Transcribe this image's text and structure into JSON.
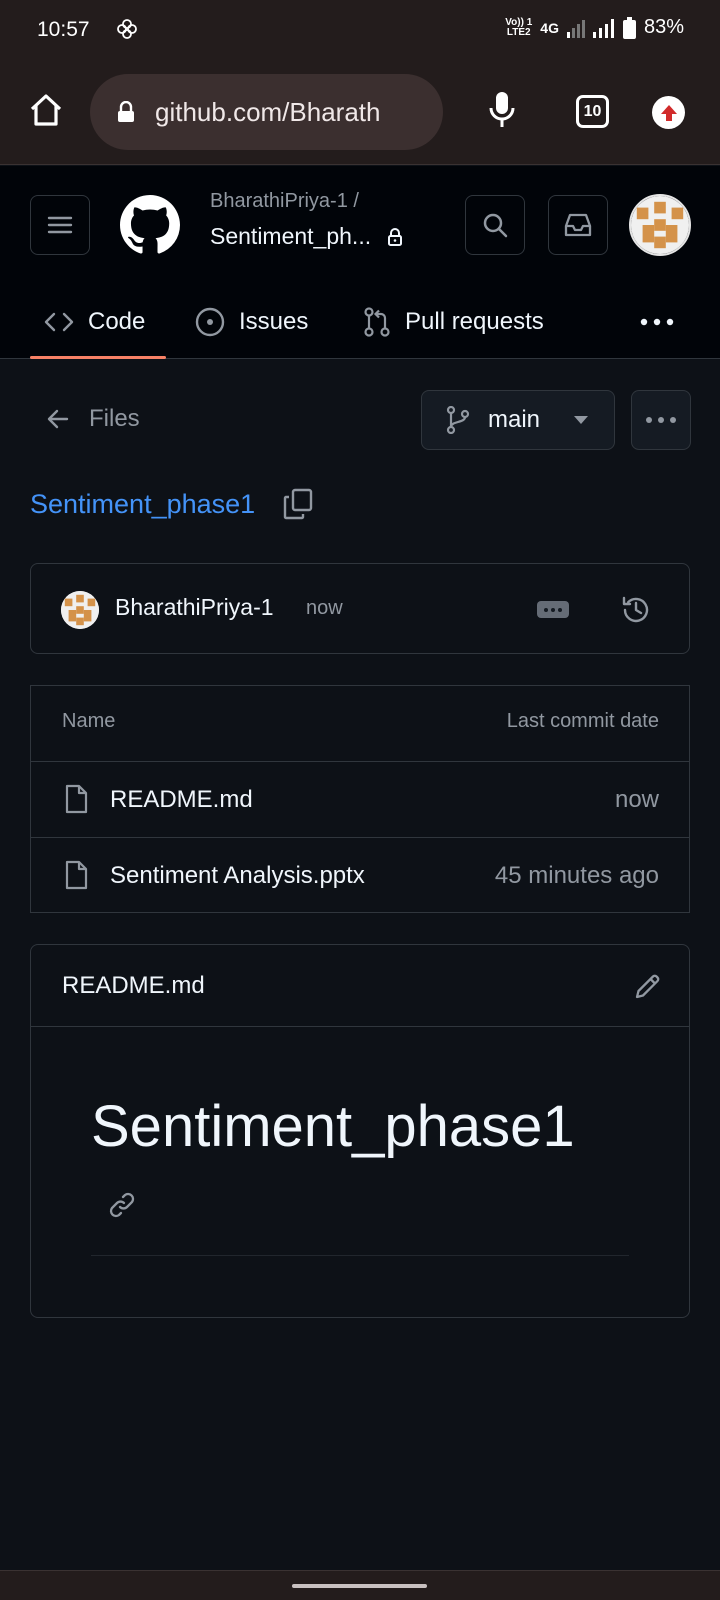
{
  "status_bar": {
    "time": "10:57",
    "volte_label": "Vo)) 1\nLTE2",
    "network": "4G",
    "battery": "83%"
  },
  "browser": {
    "url": "github.com/Bharath",
    "tab_count": "10"
  },
  "repo": {
    "owner": "BharathiPriya-1 /",
    "name": "Sentiment_ph..."
  },
  "tabs": [
    {
      "label": "Code",
      "icon": "code-icon",
      "selected": true
    },
    {
      "label": "Issues",
      "icon": "issue-opened-icon",
      "selected": false
    },
    {
      "label": "Pull requests",
      "icon": "git-pull-request-icon",
      "selected": false
    }
  ],
  "nav": {
    "back_label": "Files",
    "branch": "main"
  },
  "path": {
    "title": "Sentiment_phase1"
  },
  "commit": {
    "author": "BharathiPriya-1",
    "time": "now"
  },
  "file_table": {
    "columns": [
      "Name",
      "Last commit date"
    ],
    "rows": [
      {
        "name": "README.md",
        "date": "now"
      },
      {
        "name": "Sentiment Analysis.pptx",
        "date": "45 minutes ago"
      }
    ]
  },
  "readme": {
    "file_name": "README.md",
    "heading": "Sentiment_phase1"
  },
  "colors": {
    "background": "#0d1117",
    "header_bg": "#010409",
    "link": "#4493f8",
    "tab_underline": "#f78166",
    "border": "#30363d",
    "avatar_orange": "#d4924a"
  }
}
